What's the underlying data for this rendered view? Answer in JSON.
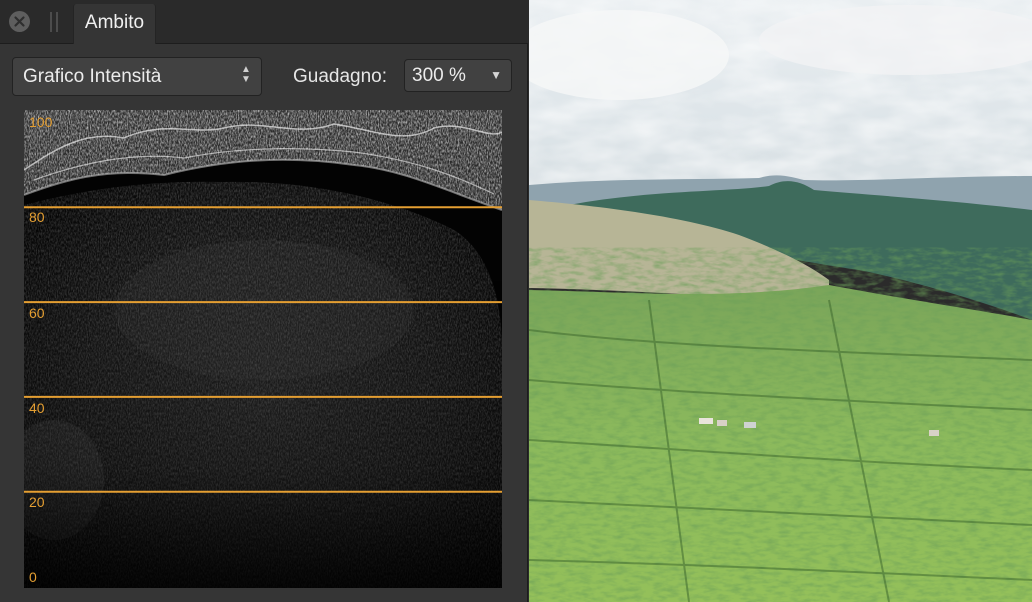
{
  "panel": {
    "tab_label": "Ambito",
    "mode_select": {
      "value": "Grafico Intensità"
    },
    "gain": {
      "label": "Guadagno:",
      "value": "300 %"
    }
  },
  "scope": {
    "ticks": [
      "100",
      "80",
      "60",
      "40",
      "20",
      "0"
    ],
    "guide_levels": [
      80,
      60,
      40,
      20
    ],
    "guide_color": "#e59f32"
  },
  "photo": {
    "description_icon": "landscape-image"
  }
}
